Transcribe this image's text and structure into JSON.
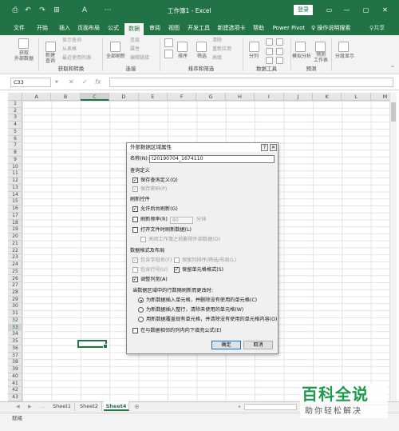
{
  "window": {
    "title": "工作簿1 - Excel",
    "login_label": "登录",
    "controls": [
      "▭",
      "—",
      "▢",
      "✕"
    ]
  },
  "qat": [
    "⎙",
    "↶",
    "↷",
    "⊞",
    "A",
    "⋯"
  ],
  "menu": {
    "tabs": [
      "文件",
      "开始",
      "插入",
      "页面布局",
      "公式",
      "数据",
      "审阅",
      "视图",
      "开发工具",
      "新建选项卡",
      "帮助",
      "Power Pivot"
    ],
    "active_index": 5,
    "tell_me": "♀ 操作说明搜索",
    "share": "♀共享"
  },
  "ribbon": {
    "get_data": "获取\n外部数据",
    "new_query": "新建\n查询",
    "query_small": [
      "显示查询",
      "从表格",
      "最近使用的源"
    ],
    "refresh_all": "全部刷新",
    "conn_small": [
      "连接",
      "属性",
      "编辑链接"
    ],
    "sort": "排序",
    "filter": "筛选",
    "sort_small": [
      "清除",
      "重新应用",
      "高级"
    ],
    "split": "分列",
    "whatif": "模拟分析",
    "forecast": "预测\n工作表",
    "outline": "分级显示",
    "groups": [
      "获取和转换",
      "连接",
      "排序和筛选",
      "数据工具",
      "预测"
    ]
  },
  "formula_bar": {
    "name_box": "C33",
    "cancel_icon": "✕",
    "enter_icon": "✓",
    "fx_icon": "fx"
  },
  "grid": {
    "columns": [
      "A",
      "B",
      "C",
      "D",
      "E",
      "F",
      "G",
      "H",
      "I",
      "J",
      "K",
      "L",
      "M"
    ],
    "selected_column": "C",
    "rows": [
      "1",
      "2",
      "3",
      "4",
      "5",
      "6",
      "7",
      "8",
      "9",
      "10",
      "11",
      "12",
      "13",
      "14",
      "15",
      "16",
      "17",
      "18",
      "19",
      "20",
      "21",
      "22",
      "23",
      "24",
      "25",
      "26",
      "27",
      "28",
      "29",
      "30",
      "31",
      "32",
      "33",
      "34",
      "35",
      "36",
      "37",
      "38",
      "39",
      "40",
      "41",
      "42",
      "43"
    ],
    "selected_row": "33"
  },
  "sheets": {
    "tabs": [
      "Sheet1",
      "Sheet2",
      "Sheet4"
    ],
    "active_index": 2,
    "nav": [
      "◀",
      "▶",
      "…"
    ]
  },
  "status": {
    "text": "就绪"
  },
  "watermark": {
    "main": "百科全说",
    "sub": "助你轻松解决"
  },
  "dialog": {
    "title": "外部数据区域属性",
    "help_btn": "?",
    "close_btn": "✕",
    "name_label": "名称(N):",
    "name_value": "t20190704_1674110",
    "sections": {
      "query_def": "查询定义",
      "refresh": "刷新控件",
      "format": "数据格式及布局",
      "update_intro": "当数据区域中的行数随刷新而更改时:"
    },
    "query_def": [
      {
        "label": "保存查询定义(Q)",
        "checked": true,
        "disabled": false
      },
      {
        "label": "保存密码(P)",
        "checked": true,
        "disabled": true
      }
    ],
    "refresh": {
      "background": {
        "label": "允许后台刷新(G)",
        "checked": true
      },
      "interval": {
        "label": "刷新频率(R)",
        "value": "60",
        "unit": "分钟",
        "checked": false
      },
      "on_open": {
        "label": "打开文件时刷新数据(L)",
        "checked": false
      },
      "remove_data": {
        "label": "关闭工作簿之前删除外部数据(D)",
        "checked": false,
        "disabled": true
      }
    },
    "format": {
      "field_names": {
        "label": "包含字段名(F)",
        "checked": true,
        "disabled": true
      },
      "row_numbers": {
        "label": "包含行号(U)",
        "checked": false,
        "disabled": true
      },
      "adjust_width": {
        "label": "调整列宽(A)",
        "checked": true
      },
      "preserve_sort": {
        "label": "保留列排序/筛选/布局(L)",
        "checked": true,
        "disabled": true
      },
      "preserve_format": {
        "label": "保留单元格格式(S)",
        "checked": true
      }
    },
    "update_options": [
      {
        "label": "为新数据插入单元格，并删除没有使用的单元格(C)",
        "selected": true
      },
      {
        "label": "为新数据插入整行，清除未使用的单元格(W)",
        "selected": false
      },
      {
        "label": "用新数据覆盖现有单元格，并清除没有使用的单元格内容(O)",
        "selected": false
      }
    ],
    "fill_down": {
      "label": "在与数据相邻的列内向下填充公式(E)",
      "checked": false
    },
    "ok_label": "确定",
    "cancel_label": "取消"
  },
  "colors": {
    "brand": "#217346",
    "watermark": "#1e9a4a"
  }
}
